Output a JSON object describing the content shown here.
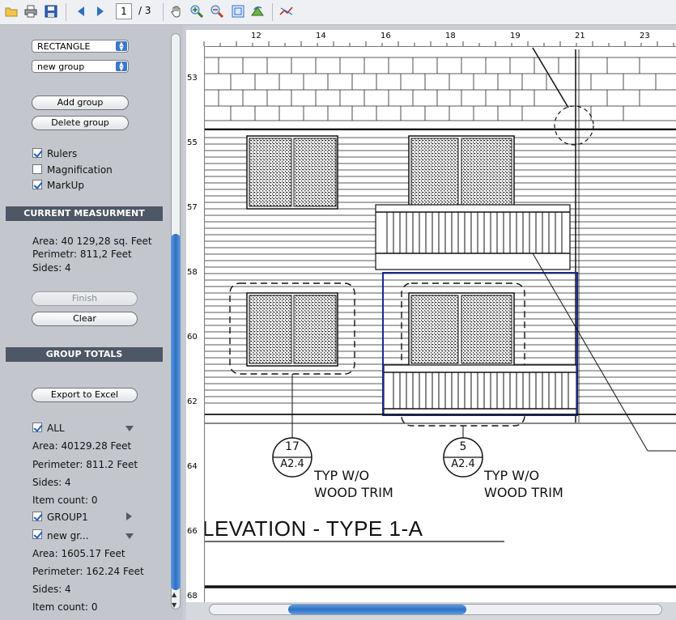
{
  "toolbar": {
    "page_current": "1",
    "page_total": "/ 3",
    "icons": [
      "open-folder-icon",
      "print-icon",
      "save-icon",
      "prev-page-icon",
      "next-page-icon",
      "hand-pan-icon",
      "zoom-in-icon",
      "zoom-out-icon",
      "fit-page-icon",
      "rotate-icon",
      "measure-tool-icon"
    ]
  },
  "sidebar": {
    "shape_select": "RECTANGLE",
    "group_select": "new group",
    "add_group": "Add group",
    "delete_group": "Delete group",
    "options": [
      {
        "label": "Rulers",
        "checked": true
      },
      {
        "label": "Magnification",
        "checked": false
      },
      {
        "label": "MarkUp",
        "checked": true
      }
    ],
    "current_title": "CURRENT MEASURMENT",
    "current": {
      "area": "Area:  40 129,28 sq. Feet",
      "perimeter": "Perimetr:  811,2 Feet",
      "sides": "Sides:  4"
    },
    "finish": "Finish",
    "clear": "Clear",
    "totals_title": "GROUP TOTALS",
    "export": "Export to Excel",
    "groups": [
      {
        "label": "ALL",
        "checked": true,
        "expanded": true,
        "area": "Area:  40129.28 Feet",
        "perimeter": "Perimeter:  811.2 Feet",
        "sides": "Sides:  4",
        "count": "Item count:  0"
      },
      {
        "label": "GROUP1",
        "checked": true,
        "expanded": false
      },
      {
        "label": "new gr...",
        "checked": true,
        "expanded": true,
        "area": "Area:  1605.17 Feet",
        "perimeter": "Perimeter:  162.24 Feet",
        "sides": "Sides:  4",
        "count": "Item count:  0"
      }
    ]
  },
  "drawing": {
    "ruler_top": [
      "12",
      "14",
      "16",
      "18",
      "19",
      "21",
      "23"
    ],
    "ruler_left": [
      "53",
      "55",
      "57",
      "58",
      "60",
      "62",
      "64",
      "66",
      "68"
    ],
    "tag1_num": "17",
    "tag1_ref": "A2.4",
    "tag2_num": "5",
    "tag2_ref": "A2.4",
    "note1_l1": "TYP W/O",
    "note1_l2": "WOOD TRIM",
    "note2_l1": "TYP W/O",
    "note2_l2": "WOOD TRIM",
    "title": "LEVATION - TYPE 1-A"
  },
  "colors": {
    "accent": "#2f70c5",
    "section_bg": "#4d5766",
    "markup": "#1a2a8a"
  }
}
